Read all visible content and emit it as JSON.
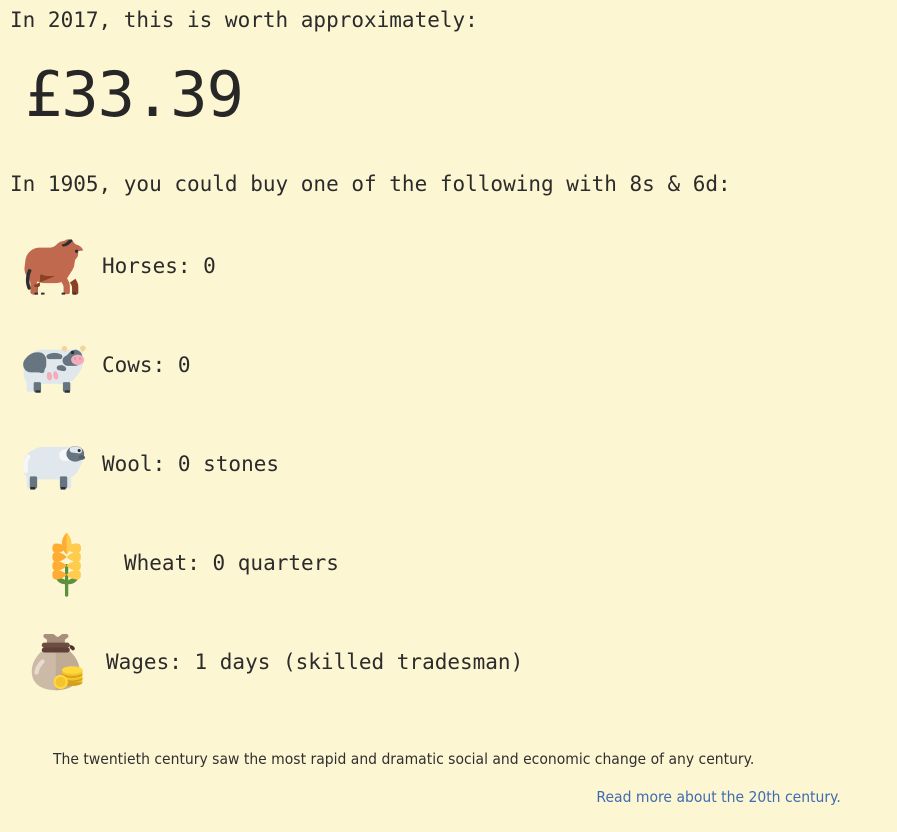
{
  "background_color": "#fdf6d3",
  "text_color": "#2b2b2b",
  "link_color": "#3f6bb0",
  "header": {
    "lead_line": "In 2017, this is worth approximately:",
    "converted_value": "£33.39",
    "sub_line": "In 1905, you could buy one of the following with 8s & 6d:"
  },
  "purchases": [
    {
      "icon": "horse-emoji",
      "label": "Horses: 0"
    },
    {
      "icon": "cow-emoji",
      "label": "Cows: 0"
    },
    {
      "icon": "sheep-emoji",
      "label": "Wool: 0 stones"
    },
    {
      "icon": "wheat-emoji",
      "label": "Wheat: 0 quarters"
    },
    {
      "icon": "money-bag-emoji",
      "label": "Wages: 1 days (skilled tradesman)"
    }
  ],
  "footer": {
    "note": "The twentieth century saw the most rapid and dramatic social and economic change of any century.",
    "link_text": "Read more about the 20th century."
  }
}
